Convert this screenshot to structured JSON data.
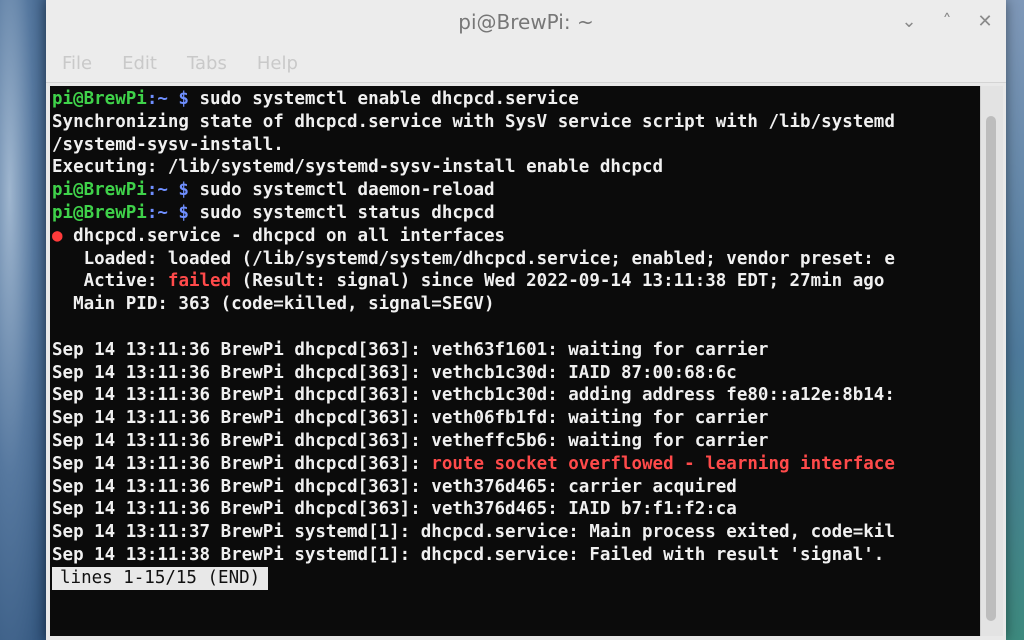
{
  "window": {
    "title": "pi@BrewPi: ~",
    "controls": {
      "minimize": "⌄",
      "maximize": "˄",
      "close": "✕"
    }
  },
  "menu": {
    "items": [
      "File",
      "Edit",
      "Tabs",
      "Help"
    ]
  },
  "terminal": {
    "prompt_user": "pi@BrewPi",
    "prompt_path": ":~ $",
    "cmd1": " sudo systemctl enable dhcpcd.service",
    "out1": "Synchronizing state of dhcpcd.service with SysV service script with /lib/systemd",
    "out2": "/systemd-sysv-install.",
    "out3": "Executing: /lib/systemd/systemd-sysv-install enable dhcpcd",
    "cmd2": " sudo systemctl daemon-reload",
    "cmd3": " sudo systemctl status dhcpcd",
    "status_dot": "●",
    "status_unit": " dhcpcd.service - dhcpcd on all interfaces",
    "loaded": "   Loaded: loaded (/lib/systemd/system/dhcpcd.service; enabled; vendor preset: e",
    "active_prefix": "   Active: ",
    "active_state": "failed",
    "active_suffix": " (Result: signal) since Wed 2022-09-14 13:11:38 EDT; 27min ago",
    "main_pid": "  Main PID: 363 (code=killed, signal=SEGV)",
    "logs": [
      {
        "prefix": "Sep 14 13:11:36 BrewPi dhcpcd[363]: ",
        "msg": "veth63f1601: waiting for carrier",
        "highlight": false
      },
      {
        "prefix": "Sep 14 13:11:36 BrewPi dhcpcd[363]: ",
        "msg": "vethcb1c30d: IAID 87:00:68:6c",
        "highlight": false
      },
      {
        "prefix": "Sep 14 13:11:36 BrewPi dhcpcd[363]: ",
        "msg": "vethcb1c30d: adding address fe80::a12e:8b14:",
        "highlight": false
      },
      {
        "prefix": "Sep 14 13:11:36 BrewPi dhcpcd[363]: ",
        "msg": "veth06fb1fd: waiting for carrier",
        "highlight": false
      },
      {
        "prefix": "Sep 14 13:11:36 BrewPi dhcpcd[363]: ",
        "msg": "vetheffc5b6: waiting for carrier",
        "highlight": false
      },
      {
        "prefix": "Sep 14 13:11:36 BrewPi dhcpcd[363]: ",
        "msg": "route socket overflowed - learning interface",
        "highlight": true
      },
      {
        "prefix": "Sep 14 13:11:36 BrewPi dhcpcd[363]: ",
        "msg": "veth376d465: carrier acquired",
        "highlight": false
      },
      {
        "prefix": "Sep 14 13:11:36 BrewPi dhcpcd[363]: ",
        "msg": "veth376d465: IAID b7:f1:f2:ca",
        "highlight": false
      },
      {
        "prefix": "Sep 14 13:11:37 BrewPi systemd[1]: ",
        "msg": "dhcpcd.service: Main process exited, code=kil",
        "highlight": false
      },
      {
        "prefix": "Sep 14 13:11:38 BrewPi systemd[1]: ",
        "msg": "dhcpcd.service: Failed with result 'signal'.",
        "highlight": false
      }
    ],
    "pager_status": "lines 1-15/15 (END)"
  },
  "colors": {
    "prompt_green": "#3fd24a",
    "prompt_blue": "#6f8fff",
    "error_red": "#ff4a4a",
    "terminal_bg": "#0b0b0b"
  }
}
